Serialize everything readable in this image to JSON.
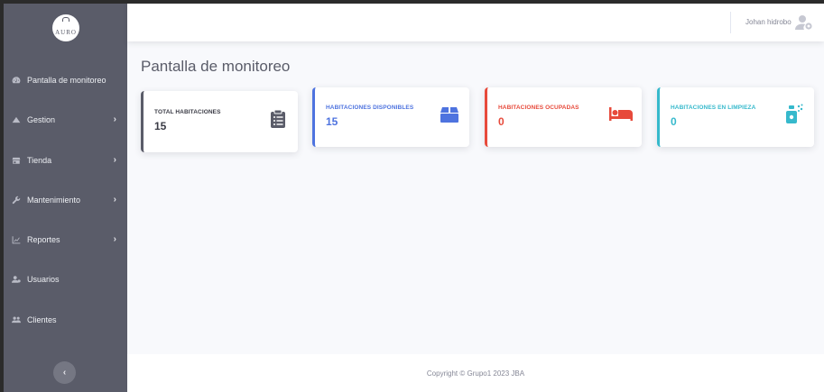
{
  "sidebar": {
    "logo_text": "AURO",
    "items": [
      {
        "label": "Pantalla de monitoreo",
        "icon": "dashboard-icon",
        "chevron": false
      },
      {
        "label": "Gestion",
        "icon": "mountain-icon",
        "chevron": true
      },
      {
        "label": "Tienda",
        "icon": "store-icon",
        "chevron": true
      },
      {
        "label": "Mantenimiento",
        "icon": "wrench-icon",
        "chevron": true
      },
      {
        "label": "Reportes",
        "icon": "chart-icon",
        "chevron": true
      },
      {
        "label": "Usuarios",
        "icon": "user-gear-icon",
        "chevron": false
      },
      {
        "label": "Clientes",
        "icon": "users-icon",
        "chevron": false
      }
    ],
    "collapse_glyph": "‹",
    "chevron_glyph": "›"
  },
  "topbar": {
    "user_name": "Johan hidrobo"
  },
  "main": {
    "title": "Pantalla de monitoreo",
    "cards": {
      "total": {
        "label": "TOTAL HABITACIONES",
        "value": "15",
        "color": "#5a5c69",
        "icon": "clipboard-list-icon"
      },
      "disponibles": {
        "label": "HABITACIONES DISPONIBLES",
        "value": "15",
        "color": "#4e73df",
        "icon": "box-icon"
      },
      "ocupadas": {
        "label": "HABITACIONES OCUPADAS",
        "value": "0",
        "color": "#e74a3b",
        "icon": "bed-icon"
      },
      "limpieza": {
        "label": "HABITACIONES EN LIMPIEZA",
        "value": "0",
        "color": "#36b9cc",
        "icon": "spray-bottle-icon"
      }
    }
  },
  "footer": {
    "text": "Copyright © Grupo1 2023 JBA"
  }
}
